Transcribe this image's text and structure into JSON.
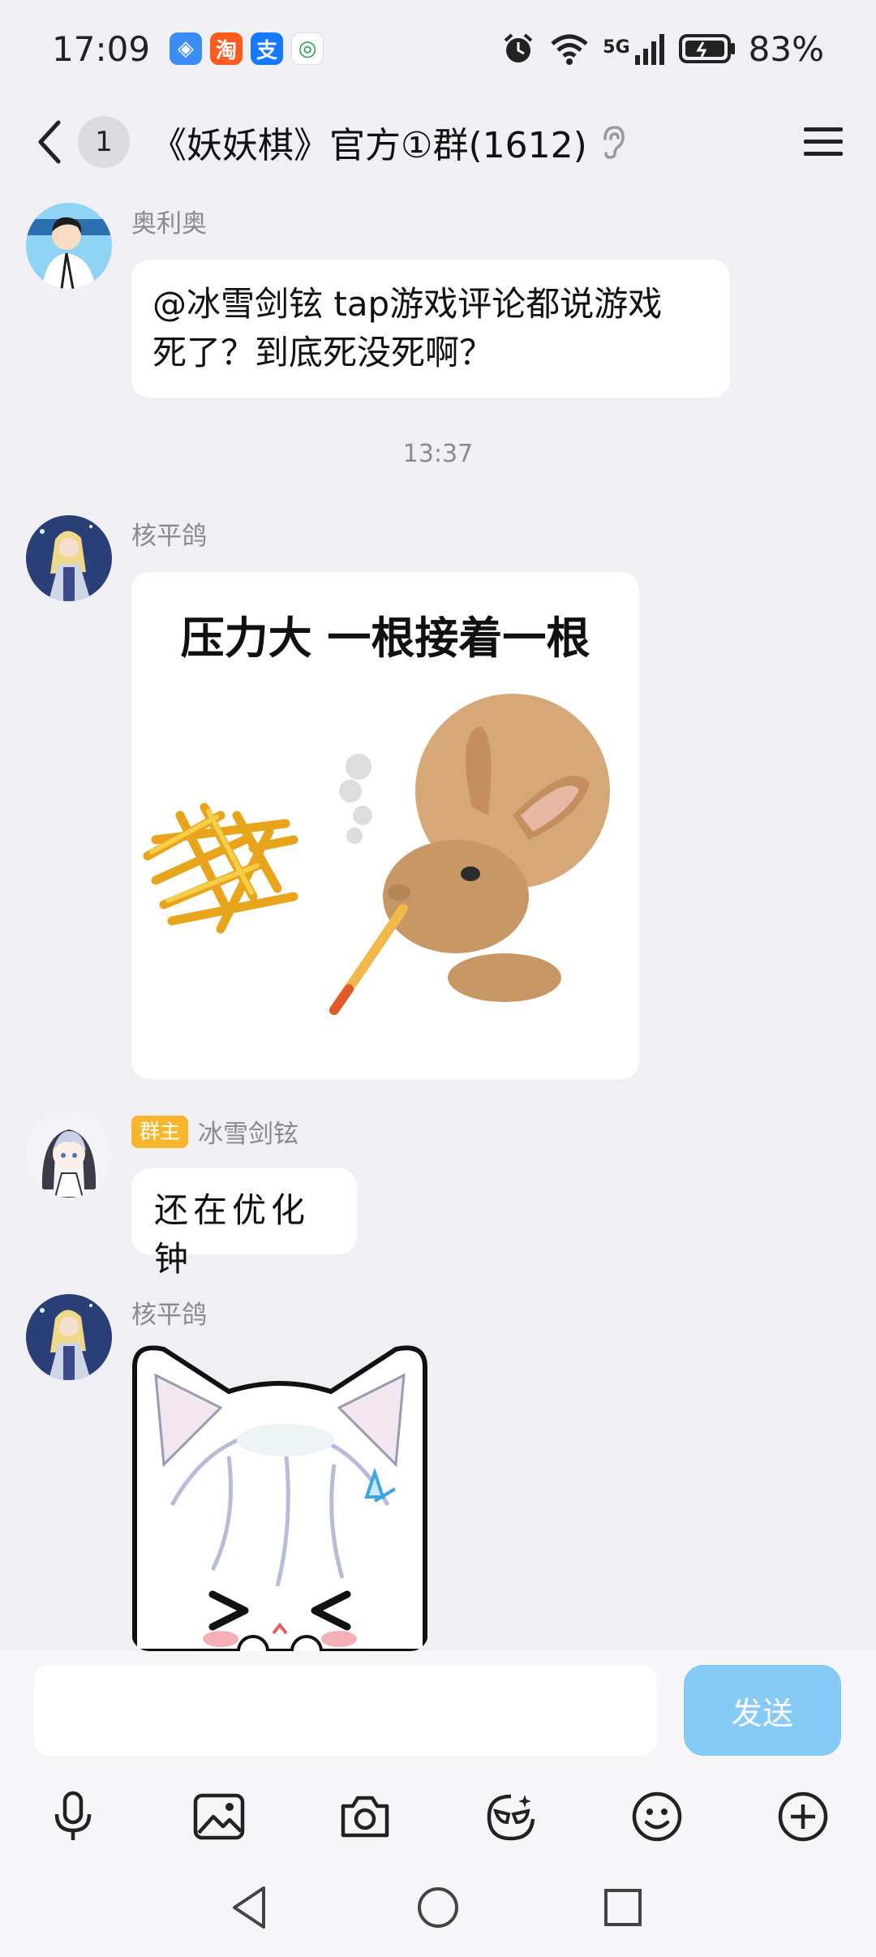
{
  "status_bar": {
    "time": "17:09",
    "apps": [
      {
        "name": "shield-app-icon",
        "glyph": "◈",
        "color": "#3b8cf5"
      },
      {
        "name": "taobao-app-icon",
        "glyph": "淘",
        "color": "#ff5a1f"
      },
      {
        "name": "alipay-app-icon",
        "glyph": "支",
        "color": "#1677ff"
      },
      {
        "name": "mobile-app-icon",
        "glyph": "◎",
        "color": "#1fa04a"
      }
    ],
    "network": "5G",
    "battery": "83%"
  },
  "header": {
    "unread_count": "1",
    "title": "《妖妖棋》官方①群(1612)"
  },
  "messages": [
    {
      "sender": "奥利奥",
      "text_line1": "@冰雪剑铉 tap游戏评论都说游戏",
      "text_line2": "死了？到底死没死啊？"
    },
    {
      "timestamp": "13:37"
    },
    {
      "sender": "核平鸽",
      "image_caption": "压力大 一根接着一根"
    },
    {
      "badge": "群主",
      "sender": "冰雪剑铉",
      "text": "还在优化钟"
    },
    {
      "sender": "核平鸽",
      "sticker": "chibi-cat-girl"
    }
  ],
  "input": {
    "placeholder": "",
    "send_label": "发送"
  },
  "colors": {
    "accent": "#86caf6",
    "badge": "#f8b62d",
    "background": "#efeff4"
  }
}
